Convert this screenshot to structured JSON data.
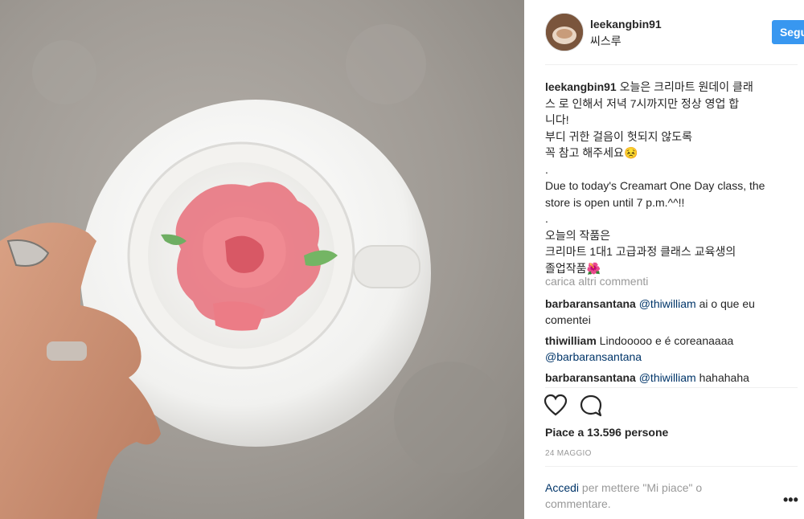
{
  "header": {
    "username": "leekangbin91",
    "location": "씨스루",
    "follow_label": "Segui"
  },
  "caption": {
    "username": "leekangbin91",
    "line1": " 오늘은 크리마트 원데이 클래",
    "lines": [
      "스 로 인해서 저녁 7시까지만 정상 영업 합",
      "니다!",
      "부디 귀한 걸음이 헛되지 않도록",
      "꼭 참고 해주세요😣",
      ".",
      "Due to today's Creamart One Day class, the",
      "store is open until 7 p.m.^^!!",
      ".",
      "오늘의 작품은",
      "크리마트 1대1 고급과정 클래스 교육생의",
      "졸업작품🌺"
    ]
  },
  "load_more": "carica altri commenti",
  "comments": [
    {
      "user": "barbaransantana",
      "mention": "@thiwilliam",
      "text": " ai o que eu",
      "line2": "comentei"
    },
    {
      "user": "thiwilliam",
      "text": " Lindooooo e é coreanaaaa",
      "mention2": "@barbaransantana"
    },
    {
      "user": "barbaransantana",
      "mention": "@thiwilliam",
      "text": " hahahaha"
    }
  ],
  "likes": "Piace a 13.596 persone",
  "date": "24 MAGGIO",
  "login": {
    "link": "Accedi",
    "rest": " per mettere \"Mi piace\" o",
    "line2": "commentare."
  },
  "more_icon": "•••",
  "icons": {
    "like": "heart-icon",
    "comment": "comment-icon"
  }
}
